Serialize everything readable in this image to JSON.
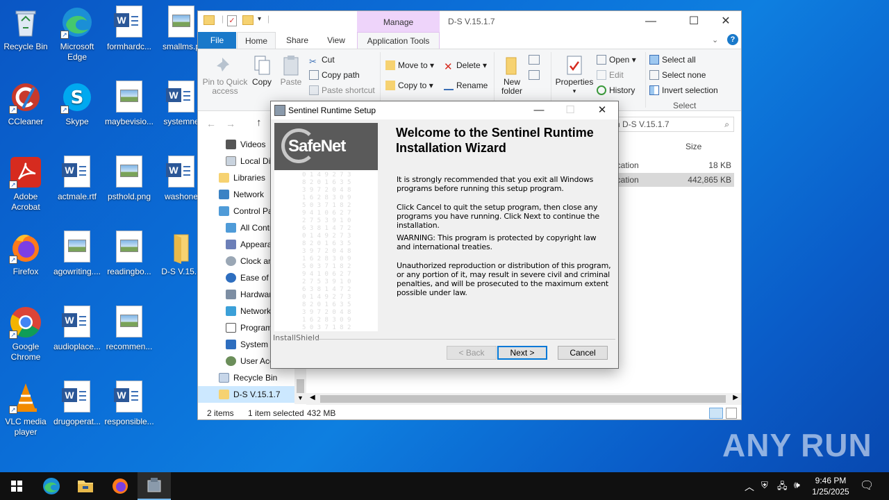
{
  "desktop": {
    "icons": [
      {
        "label": "Recycle Bin"
      },
      {
        "label": "Microsoft Edge"
      },
      {
        "label": "formhardc..."
      },
      {
        "label": "smallms.p"
      },
      {
        "label": "CCleaner"
      },
      {
        "label": "Skype"
      },
      {
        "label": "maybevisio..."
      },
      {
        "label": "systemne"
      },
      {
        "label": "Adobe Acrobat"
      },
      {
        "label": "actmale.rtf"
      },
      {
        "label": "psthold.png"
      },
      {
        "label": "washone"
      },
      {
        "label": "Firefox"
      },
      {
        "label": "agowriting...."
      },
      {
        "label": "readingbo..."
      },
      {
        "label": "D-S V.15.1"
      },
      {
        "label": "Google Chrome"
      },
      {
        "label": "audioplace..."
      },
      {
        "label": "recommen..."
      },
      {
        "label": "VLC media player"
      },
      {
        "label": "drugoperat..."
      },
      {
        "label": "responsible..."
      }
    ]
  },
  "explorer": {
    "title": "D-S V.15.1.7",
    "manage_label": "Manage",
    "tabs": {
      "file": "File",
      "home": "Home",
      "share": "Share",
      "view": "View",
      "app_tools": "Application Tools"
    },
    "ribbon": {
      "pin": "Pin to Quick access",
      "copy": "Copy",
      "paste": "Paste",
      "cut": "Cut",
      "copy_path": "Copy path",
      "paste_shortcut": "Paste shortcut",
      "move_to": "Move to",
      "copy_to": "Copy to",
      "delete": "Delete",
      "rename": "Rename",
      "new_folder": "New folder",
      "properties": "Properties",
      "open": "Open",
      "edit": "Edit",
      "history": "History",
      "select_all": "Select all",
      "select_none": "Select none",
      "invert_selection": "Invert selection",
      "select_group": "Select"
    },
    "search_placeholder": "h D-S V.15.1.7",
    "size_header": "Size",
    "files": [
      {
        "type": "ication",
        "size": "18 KB"
      },
      {
        "type": "ication",
        "size": "442,865 KB"
      }
    ],
    "tree": [
      {
        "label": "Videos"
      },
      {
        "label": "Local Dis"
      },
      {
        "label": "Libraries"
      },
      {
        "label": "Network"
      },
      {
        "label": "Control Pa"
      },
      {
        "label": "All Contr"
      },
      {
        "label": "Appeara"
      },
      {
        "label": "Clock an"
      },
      {
        "label": "Ease of A"
      },
      {
        "label": "Hardwar"
      },
      {
        "label": "Network"
      },
      {
        "label": "Program"
      },
      {
        "label": "System a"
      },
      {
        "label": "User Acc"
      },
      {
        "label": "Recycle Bin"
      },
      {
        "label": "D-S V.15.1.7"
      }
    ],
    "status": {
      "items": "2 items",
      "selected": "1 item selected",
      "size": "432 MB"
    }
  },
  "dialog": {
    "title": "Sentinel Runtime Setup",
    "logo_text": "SafeNet",
    "heading": "Welcome to the Sentinel Runtime Installation Wizard",
    "p1": "It is strongly recommended that you exit all Windows programs before running this setup program.",
    "p2": "Click Cancel to quit the setup program, then close any programs you have running.  Click Next to continue the installation.",
    "p3": "WARNING: This program is protected by copyright law and international treaties.",
    "p4": "Unauthorized reproduction or distribution of this program, or any portion of it, may result in severe civil and criminal penalties, and will be prosecuted to the maximum extent possible under law.",
    "installshield": "InstallShield",
    "back": "< Back",
    "next": "Next >",
    "cancel": "Cancel"
  },
  "taskbar": {
    "time": "9:46 PM",
    "date": "1/25/2025"
  },
  "watermark": "ANY RUN",
  "colors": {
    "accent": "#0078d7",
    "file_tab": "#1979ca",
    "manage": "#eed4fa"
  }
}
